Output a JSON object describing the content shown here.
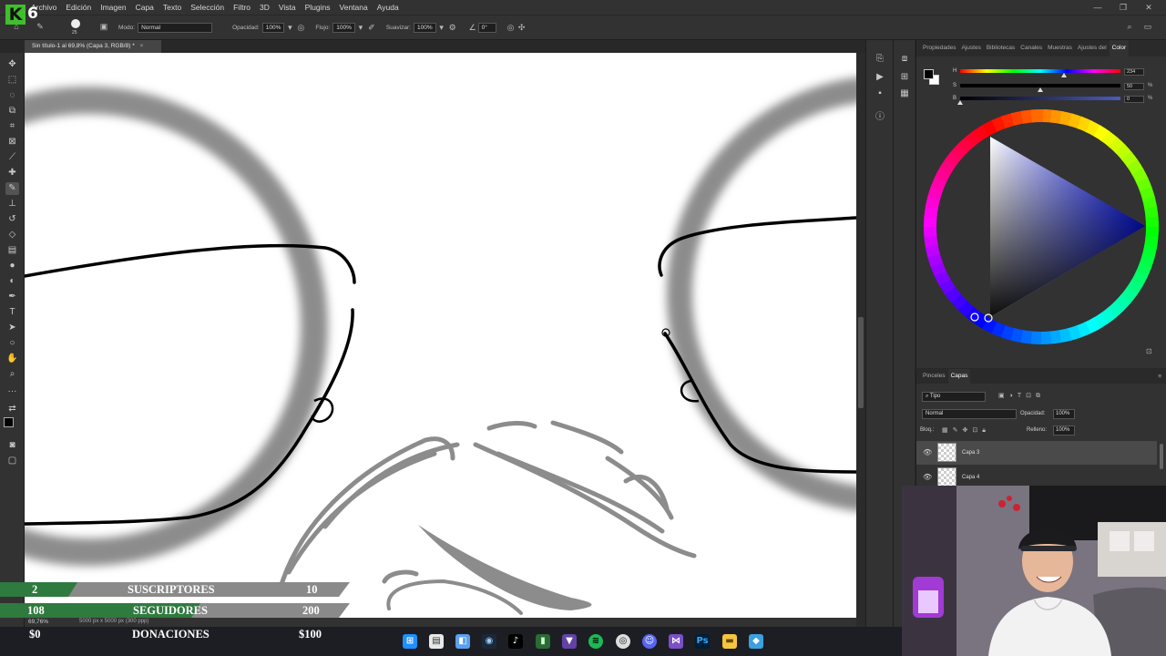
{
  "stream": {
    "logo_letter": "K",
    "logo_number": "6"
  },
  "menu": [
    "Archivo",
    "Edición",
    "Imagen",
    "Capa",
    "Texto",
    "Selección",
    "Filtro",
    "3D",
    "Vista",
    "Plugins",
    "Ventana",
    "Ayuda"
  ],
  "options": {
    "brush_size": "25",
    "mode_label": "Modo:",
    "mode_value": "Normal",
    "opacity_label": "Opacidad:",
    "opacity_value": "100%",
    "flow_label": "Flujo:",
    "flow_value": "100%",
    "smoothing_label": "Suavizar:",
    "smoothing_value": "100%",
    "angle_value": "0°"
  },
  "document": {
    "tab_title": "Sin título-1 al 69,8% (Capa 3, RGB/8) *",
    "zoom": "69,76%",
    "doc_info": "5000 px x 5000 px (300 ppp)"
  },
  "color_panel": {
    "tabs": [
      "Propiedades",
      "Ajustes",
      "Bibliotecas",
      "Canales",
      "Muestras",
      "Ajustes del",
      "Color"
    ],
    "active_tab": "Color",
    "h_label": "H",
    "s_label": "S",
    "b_label": "B",
    "h_value": "234",
    "s_value": "50",
    "b_value": "0",
    "h_level": 0.65,
    "s_level": 0.5,
    "b_level": 0.0,
    "unit": "%"
  },
  "layers_panel": {
    "tabs": [
      "Pinceles",
      "Capas"
    ],
    "active_tab": "Capas",
    "filter_label": "Tipo",
    "blend_mode": "Normal",
    "opacity_label": "Opacidad:",
    "opacity_value": "100%",
    "lock_label": "Bloq.:",
    "fill_label": "Relleno:",
    "fill_value": "100%",
    "layers": [
      {
        "name": "Capa 3",
        "selected": true
      },
      {
        "name": "Capa 4",
        "selected": false
      }
    ]
  },
  "overlay": {
    "suscriptores": {
      "current": "2",
      "label": "SUSCRIPTORES",
      "goal": "10"
    },
    "seguidores": {
      "current": "108",
      "label": "SEGUIDORES",
      "goal": "200"
    },
    "donaciones": {
      "current": "$0",
      "label": "DONACIONES",
      "goal": "$100"
    }
  },
  "colors": {
    "ps_panel": "#323232",
    "ps_dark": "#1e1e1e",
    "overlay_green": "#2f7a3f",
    "overlay_gray": "#8a8a8a",
    "canvas_gray_stroke": "#8c8c8c"
  },
  "taskbar_icons": [
    "windows-icon",
    "file-explorer-icon",
    "store-icon",
    "steam-icon",
    "tiktok-icon",
    "phone-icon",
    "twitch-icon",
    "spotify-icon",
    "chrome-icon",
    "discord-icon",
    "visual-studio-icon",
    "photoshop-icon",
    "folder-icon",
    "maps-icon"
  ]
}
